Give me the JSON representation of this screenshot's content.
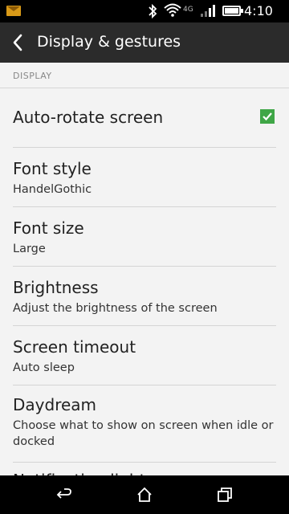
{
  "status_bar": {
    "network_type": "4G",
    "time": "4:10 pm",
    "icons": [
      "mail-icon",
      "bluetooth-icon",
      "wifi-icon",
      "signal-icon",
      "battery-icon"
    ]
  },
  "header": {
    "title": "Display & gestures"
  },
  "section": {
    "label": "DISPLAY"
  },
  "settings": {
    "auto_rotate": {
      "title": "Auto-rotate screen",
      "checked": true
    },
    "font_style": {
      "title": "Font style",
      "value": "HandelGothic"
    },
    "font_size": {
      "title": "Font size",
      "value": "Large"
    },
    "brightness": {
      "title": "Brightness",
      "subtitle": "Adjust the brightness of the screen"
    },
    "screen_timeout": {
      "title": "Screen timeout",
      "value": "Auto sleep"
    },
    "daydream": {
      "title": "Daydream",
      "subtitle": "Choose what to show on screen when idle or docked"
    },
    "notification_light": {
      "title": "Notification light"
    }
  },
  "colors": {
    "header_bg": "#2b2b2b",
    "checkbox": "#3fa646",
    "background": "#f3f3f3"
  }
}
